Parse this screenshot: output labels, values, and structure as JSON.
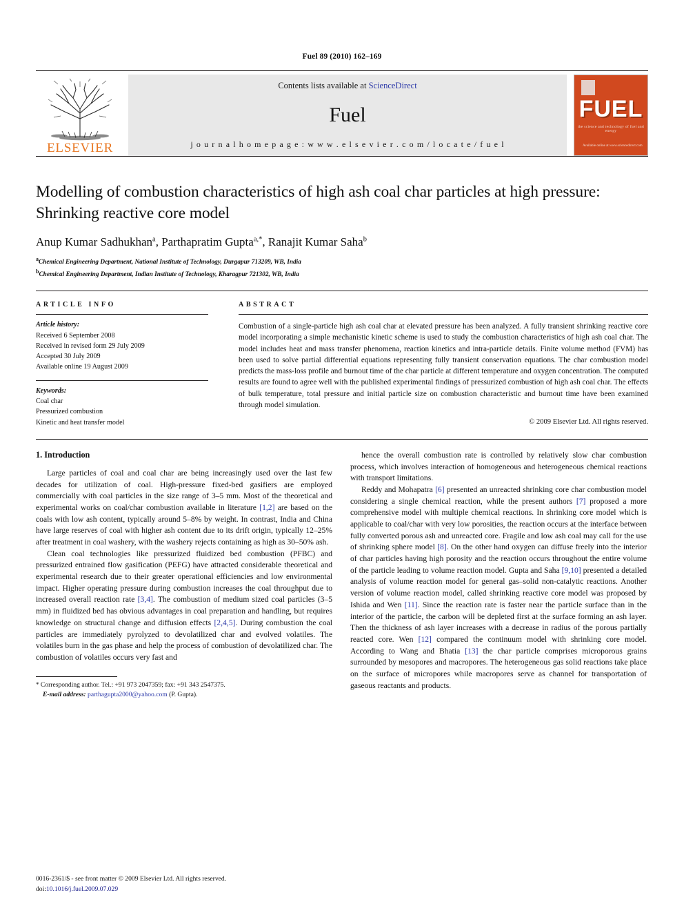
{
  "running_head": "Fuel 89 (2010) 162–169",
  "masthead": {
    "contents_prefix": "Contents lists available at ",
    "sciencedirect": "ScienceDirect",
    "journal_name": "Fuel",
    "homepage": "j o u r n a l   h o m e p a g e :   w w w . e l s e v i e r . c o m / l o c a t e / f u e l",
    "elsevier_wordmark": "ELSEVIER",
    "cover": {
      "title": "FUEL",
      "subtitle": "the science and technology of fuel and energy",
      "footer": "Available online at www.sciencedirect.com"
    }
  },
  "article": {
    "title": "Modelling of combustion characteristics of high ash coal char particles at high pressure: Shrinking reactive core model",
    "authors": "Anup Kumar Sadhukhan",
    "authors_full": [
      {
        "name": "Anup Kumar Sadhukhan",
        "sup": "a"
      },
      {
        "name": "Parthapratim Gupta",
        "sup": "a,*"
      },
      {
        "name": "Ranajit Kumar Saha",
        "sup": "b"
      }
    ],
    "affiliations": [
      {
        "sup": "a",
        "text": "Chemical Engineering Department, National Institute of Technology, Durgapur 713209, WB, India"
      },
      {
        "sup": "b",
        "text": "Chemical Engineering Department, Indian Institute of Technology, Kharagpur 721302, WB, India"
      }
    ]
  },
  "info": {
    "heading": "ARTICLE INFO",
    "history_label": "Article history:",
    "history": [
      "Received 6 September 2008",
      "Received in revised form 29 July 2009",
      "Accepted 30 July 2009",
      "Available online 19 August 2009"
    ],
    "keywords_label": "Keywords:",
    "keywords": [
      "Coal char",
      "Pressurized combustion",
      "Kinetic and heat transfer model"
    ]
  },
  "abstract": {
    "heading": "ABSTRACT",
    "text": "Combustion of a single-particle high ash coal char at elevated pressure has been analyzed. A fully transient shrinking reactive core model incorporating a simple mechanistic kinetic scheme is used to study the combustion characteristics of high ash coal char. The model includes heat and mass transfer phenomena, reaction kinetics and intra-particle details. Finite volume method (FVM) has been used to solve partial differential equations representing fully transient conservation equations. The char combustion model predicts the mass-loss profile and burnout time of the char particle at different temperature and oxygen concentration. The computed results are found to agree well with the published experimental findings of pressurized combustion of high ash coal char. The effects of bulk temperature, total pressure and initial particle size on combustion characteristic and burnout time have been examined through model simulation.",
    "copyright": "© 2009 Elsevier Ltd. All rights reserved."
  },
  "body": {
    "section_heading": "1. Introduction",
    "left_paragraphs": [
      "Large particles of coal and coal char are being increasingly used over the last few decades for utilization of coal. High-pressure fixed-bed gasifiers are employed commercially with coal particles in the size range of 3–5 mm. Most of the theoretical and experimental works on coal/char combustion available in literature [1,2] are based on the coals with low ash content, typically around 5–8% by weight. In contrast, India and China have large reserves of coal with higher ash content due to its drift origin, typically 12–25% after treatment in coal washery, with the washery rejects containing as high as 30–50% ash.",
      "Clean coal technologies like pressurized fluidized bed combustion (PFBC) and pressurized entrained flow gasification (PEFG) have attracted considerable theoretical and experimental research due to their greater operational efficiencies and low environmental impact. Higher operating pressure during combustion increases the coal throughput due to increased overall reaction rate [3,4]. The combustion of medium sized coal particles (3–5 mm) in fluidized bed has obvious advantages in coal preparation and handling, but requires knowledge on structural change and diffusion effects [2,4,5]. During combustion the coal particles are immediately pyrolyzed to devolatilized char and evolved volatiles. The volatiles burn in the gas phase and help the process of combustion of devolatilized char. The combustion of volatiles occurs very fast and"
    ],
    "right_paragraphs": [
      "hence the overall combustion rate is controlled by relatively slow char combustion process, which involves interaction of homogeneous and heterogeneous chemical reactions with transport limitations.",
      "Reddy and Mohapatra [6] presented an unreacted shrinking core char combustion model considering a single chemical reaction, while the present authors [7] proposed a more comprehensive model with multiple chemical reactions. In shrinking core model which is applicable to coal/char with very low porosities, the reaction occurs at the interface between fully converted porous ash and unreacted core. Fragile and low ash coal may call for the use of shrinking sphere model [8]. On the other hand oxygen can diffuse freely into the interior of char particles having high porosity and the reaction occurs throughout the entire volume of the particle leading to volume reaction model. Gupta and Saha [9,10] presented a detailed analysis of volume reaction model for general gas–solid non-catalytic reactions. Another version of volume reaction model, called shrinking reactive core model was proposed by Ishida and Wen [11]. Since the reaction rate is faster near the particle surface than in the interior of the particle, the carbon will be depleted first at the surface forming an ash layer. Then the thickness of ash layer increases with a decrease in radius of the porous partially reacted core. Wen [12] compared the continuum model with shrinking core model. According to Wang and Bhatia [13] the char particle comprises microporous grains surrounded by mesopores and macropores. The heterogeneous gas solid reactions take place on the surface of micropores while macropores serve as channel for transportation of gaseous reactants and products."
    ]
  },
  "footnote": {
    "marker": "*",
    "corresponding": "Corresponding author. Tel.: +91 973 2047359; fax: +91 343 2547375.",
    "email_label": "E-mail address:",
    "email": "parthagupta2000@yahoo.com",
    "email_owner": "(P. Gupta)."
  },
  "page_footer": {
    "issn_line": "0016-2361/$ - see front matter © 2009 Elsevier Ltd. All rights reserved.",
    "doi_label": "doi:",
    "doi": "10.1016/j.fuel.2009.07.029"
  },
  "colors": {
    "link": "#2b38a8",
    "elsevier_orange": "#e87722",
    "cover_red": "#d1491f"
  }
}
